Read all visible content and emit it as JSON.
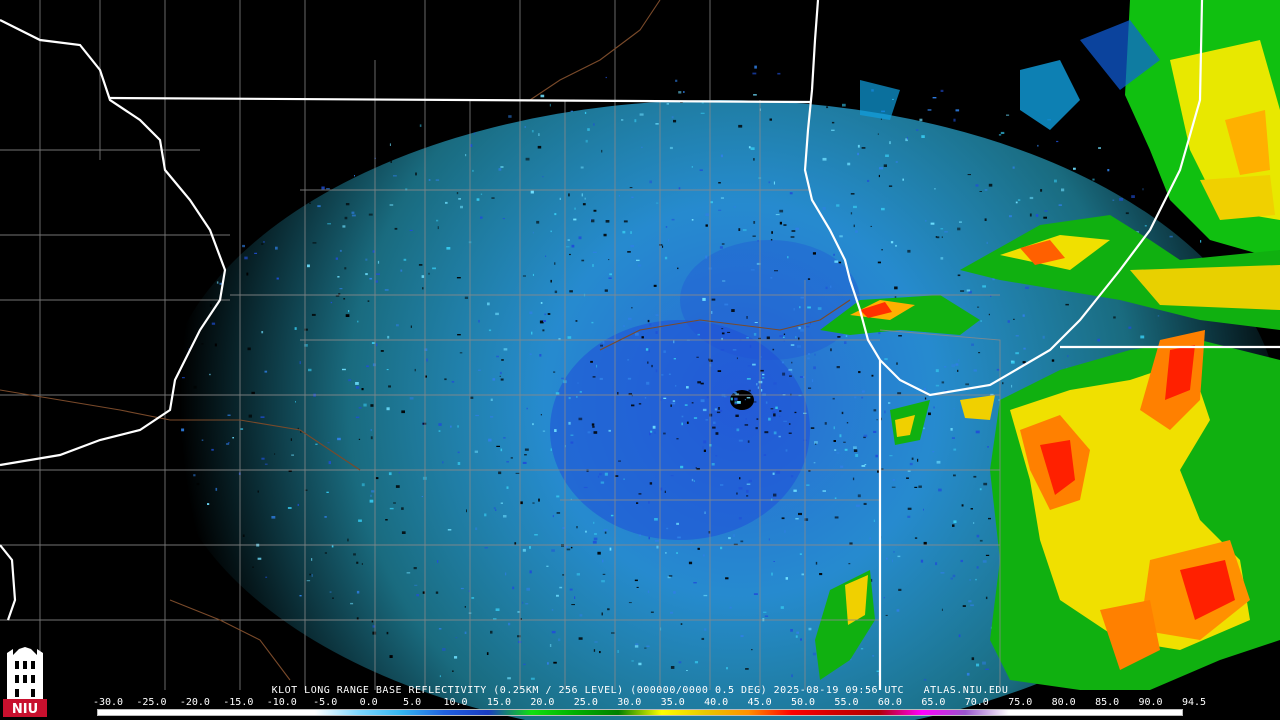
{
  "title": "KLOT LONG RANGE BASE REFLECTIVITY (0.25KM / 256 LEVEL) (000000/0000 0.5 DEG) 2025-08-19 09:56 UTC",
  "source": "ATLAS.NIU.EDU",
  "logo_text": "NIU",
  "scale": {
    "labels": [
      "-30.0",
      "-25.0",
      "-20.0",
      "-15.0",
      "-10.0",
      "-5.0",
      "0.0",
      "5.0",
      "10.0",
      "15.0",
      "20.0",
      "25.0",
      "30.0",
      "35.0",
      "40.0",
      "45.0",
      "50.0",
      "55.0",
      "60.0",
      "65.0",
      "70.0",
      "75.0",
      "80.0",
      "85.0",
      "90.0",
      "94.5"
    ],
    "colors": [
      "#ffffff",
      "#ffffff",
      "#ffffff",
      "#ffffff",
      "#ffffff",
      "#ffffff",
      "#7fd8ff",
      "#33b5f0",
      "#2060e0",
      "#1a3cc0",
      "#10e010",
      "#00b000",
      "#008000",
      "#ffff00",
      "#e8c800",
      "#ff9000",
      "#ff0000",
      "#d00000",
      "#b00000",
      "#ff00ff",
      "#9955cc",
      "#ffffff",
      "#ffffff",
      "#ffffff",
      "#ffffff",
      "#ffffff"
    ]
  },
  "map_colors": {
    "background": "#000000",
    "state_border": "#ffffff",
    "county_border": "#8a8a8a",
    "river": "#7a4a2a"
  }
}
